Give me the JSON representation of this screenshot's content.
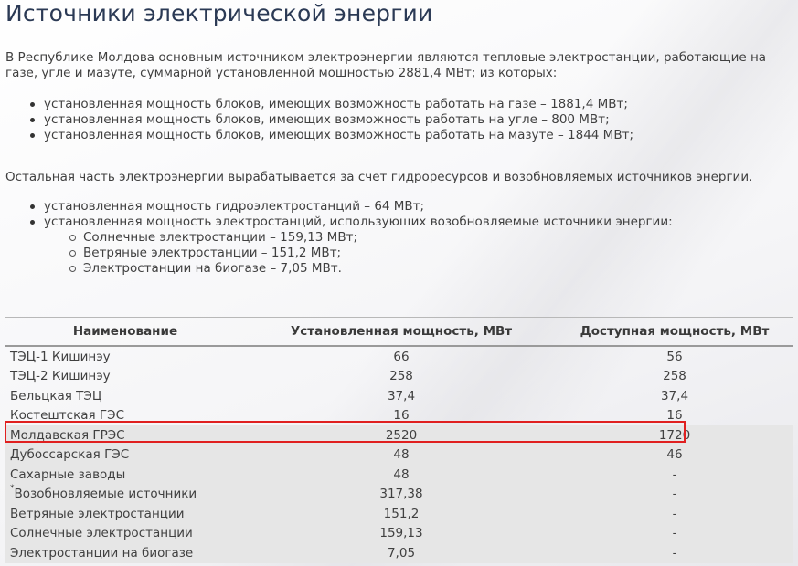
{
  "title": "Источники электрической энергии",
  "intro": "В Республике Молдова основным источником электроэнергии  являются тепловые электростанции, работающие на газе, угле и мазуте, суммарной установленной мощностью 2881,4 МВт; из которых:",
  "thermal_list": [
    "установленная мощность блоков, имеющих возможность работать на газе – 1881,4 МВт;",
    "установленная мощность блоков, имеющих возможность работать на угле – 800 МВт;",
    "установленная мощность блоков, имеющих возможность работать на мазуте – 1844 МВт;"
  ],
  "remaining_text": "Остальная часть электроэнергии вырабатывается за счет гидроресурсов и возобновляемых источников энергии.",
  "remaining_list": {
    "hydro": "установленная мощность гидроэлектростанций – 64 МВт;",
    "renewable": "установленная мощность электростанций, использующих возобновляемые источники энергии:",
    "renewable_sub": [
      "Солнечные электростанции – 159,13 МВт;",
      "Ветряные электростанции – 151,2 МВт;",
      "Электростанции на биогазе – 7,05 МВт."
    ]
  },
  "table": {
    "headers": [
      "Наименование",
      "Установленная мощность, МВт",
      "Доступная мощность, МВт"
    ],
    "rows": [
      {
        "name": "ТЭЦ-1 Кишинэу",
        "installed": "66",
        "available": "56"
      },
      {
        "name": "ТЭЦ-2 Кишинэу",
        "installed": "258",
        "available": "258"
      },
      {
        "name": "Бельцкая ТЭЦ",
        "installed": "37,4",
        "available": "37,4"
      },
      {
        "name": "Костештская ГЭС",
        "installed": "16",
        "available": "16"
      },
      {
        "name": "Молдавская ГРЭС",
        "installed": "2520",
        "available": "1720"
      },
      {
        "name": "Дубоссарская ГЭС",
        "installed": "48",
        "available": "46"
      },
      {
        "name": "Сахарные заводы",
        "installed": "48",
        "available": "-"
      },
      {
        "name": "Возобновляемые источники",
        "mark": "*",
        "installed": "317,38",
        "available": "-"
      },
      {
        "name": "Ветряные электростанции",
        "installed": "151,2",
        "available": "-"
      },
      {
        "name": "Солнечные электростанции",
        "installed": "159,13",
        "available": "-"
      },
      {
        "name": "Электростанции на биогазе",
        "installed": "7,05",
        "available": "-"
      }
    ]
  },
  "colors": {
    "title": "#2b3a55",
    "highlight_border": "#e02020",
    "shaded_row": "#e6e6e6"
  }
}
